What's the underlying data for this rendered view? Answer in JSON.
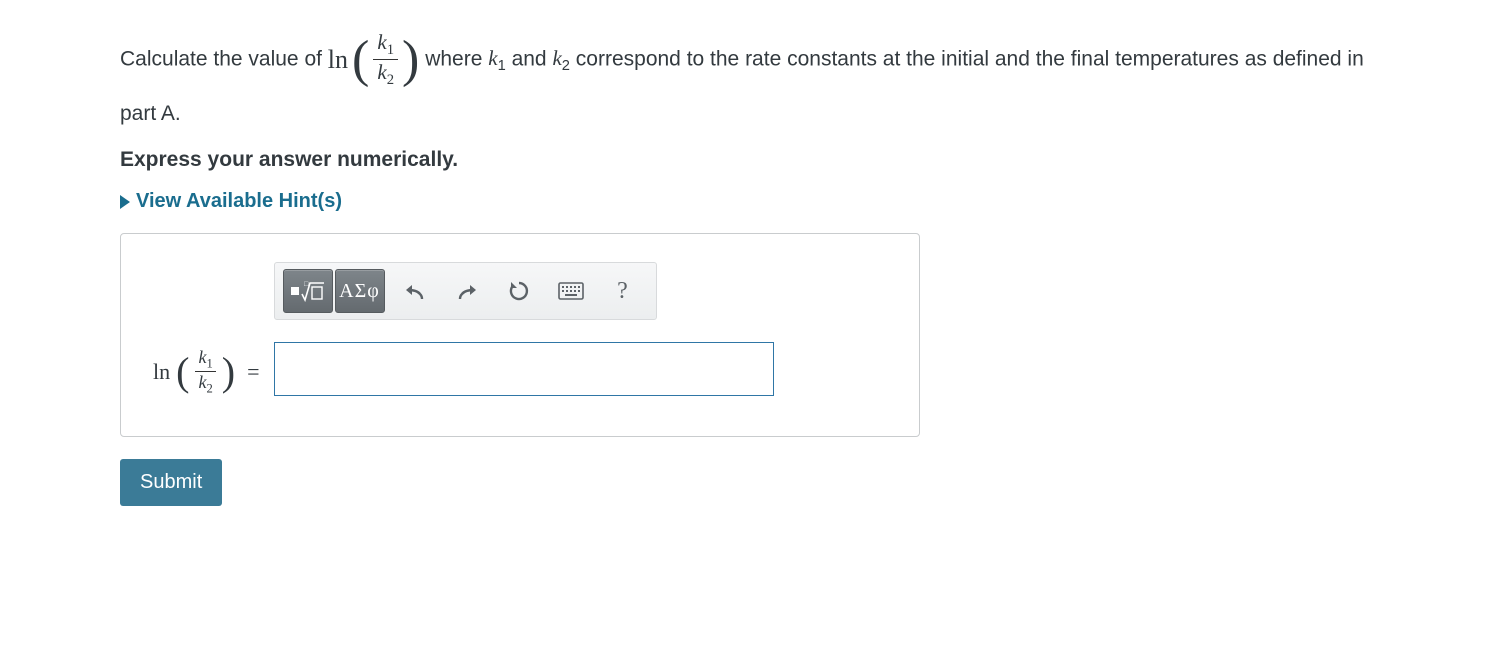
{
  "question": {
    "text_before_math": "Calculate the value of ",
    "ln_label": "ln",
    "frac_num": "k",
    "frac_num_sub": "1",
    "frac_den": "k",
    "frac_den_sub": "2",
    "text_after_math_1": " where ",
    "k1_var": "k",
    "k1_sub": "1",
    "and_text": " and ",
    "k2_var": "k",
    "k2_sub": "2",
    "text_after_math_2": " correspond to the rate constants at the initial and the final temperatures as defined in part A."
  },
  "instruction": "Express your answer numerically.",
  "hints_label": "View Available Hint(s)",
  "toolbar": {
    "greek_label": "ΑΣφ",
    "help_label": "?"
  },
  "lhs": {
    "ln": "ln",
    "num_var": "k",
    "num_sub": "1",
    "den_var": "k",
    "den_sub": "2",
    "equals": "="
  },
  "answer_value": "",
  "submit_label": "Submit"
}
